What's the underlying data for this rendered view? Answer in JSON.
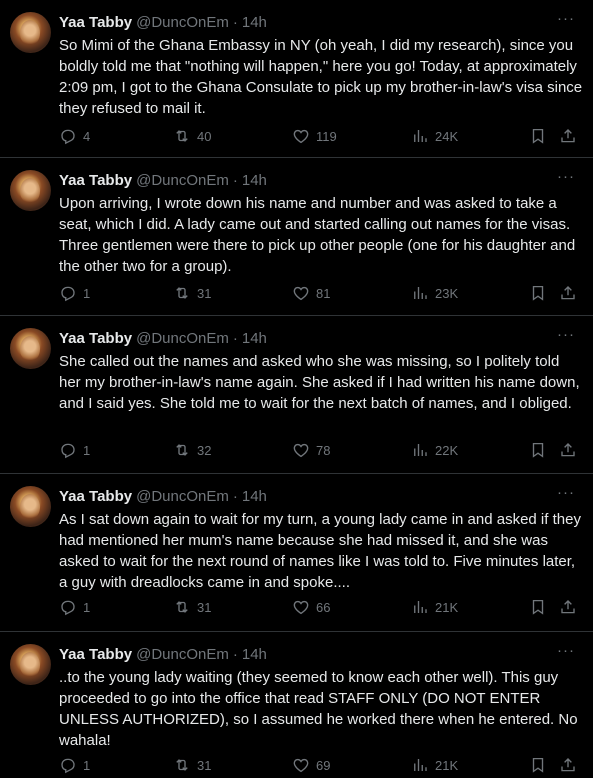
{
  "tweets": [
    {
      "name": "Yaa Tabby",
      "handle": "@DuncOnEm",
      "time": "14h",
      "text": "So Mimi of the Ghana Embassy in NY (oh yeah, I did my research), since you boldly told me that \"nothing will happen,\" here you go! Today, at approximately 2:09 pm, I got to the Ghana Consulate to pick up my brother-in-law's visa since they refused to mail it.",
      "replies": "4",
      "reposts": "40",
      "likes": "119",
      "views": "24K"
    },
    {
      "name": "Yaa Tabby",
      "handle": "@DuncOnEm",
      "time": "14h",
      "text": "Upon arriving, I wrote down his name and number and was asked to take a seat, which I did. A lady came out and started calling out names for the visas. Three gentlemen were there to pick up other people (one for his daughter and the other two for a group).",
      "replies": "1",
      "reposts": "31",
      "likes": "81",
      "views": "23K"
    },
    {
      "name": "Yaa Tabby",
      "handle": "@DuncOnEm",
      "time": "14h",
      "text": "She called out the names and asked who she was missing, so I politely told her my brother-in-law's name again. She asked if I had written his name down, and I said yes. She told me to wait for the next batch of names, and I obliged.",
      "replies": "1",
      "reposts": "32",
      "likes": "78",
      "views": "22K"
    },
    {
      "name": "Yaa Tabby",
      "handle": "@DuncOnEm",
      "time": "14h",
      "text": "As I sat down again to wait for my turn, a young lady came in and asked if they had mentioned her mum's name because she had missed it, and she was asked to wait for the next round of names like I was told to. Five minutes later, a guy with dreadlocks came in and spoke....",
      "replies": "1",
      "reposts": "31",
      "likes": "66",
      "views": "21K"
    },
    {
      "name": "Yaa Tabby",
      "handle": "@DuncOnEm",
      "time": "14h",
      "text": "..to the young lady waiting (they seemed to know each other well). This guy proceeded to go into the office that read STAFF ONLY (DO NOT ENTER UNLESS AUTHORIZED), so I assumed he worked there when he entered. No wahala!",
      "replies": "1",
      "reposts": "31",
      "likes": "69",
      "views": "21K"
    }
  ],
  "separator": "·",
  "more_glyph": "···",
  "icons": [
    "reply-icon",
    "repost-icon",
    "like-icon",
    "views-icon",
    "bookmark-icon",
    "share-icon"
  ],
  "colors": {
    "background": "#000000",
    "text": "#e7e9ea",
    "muted": "#71767b",
    "divider": "#2f3336"
  }
}
